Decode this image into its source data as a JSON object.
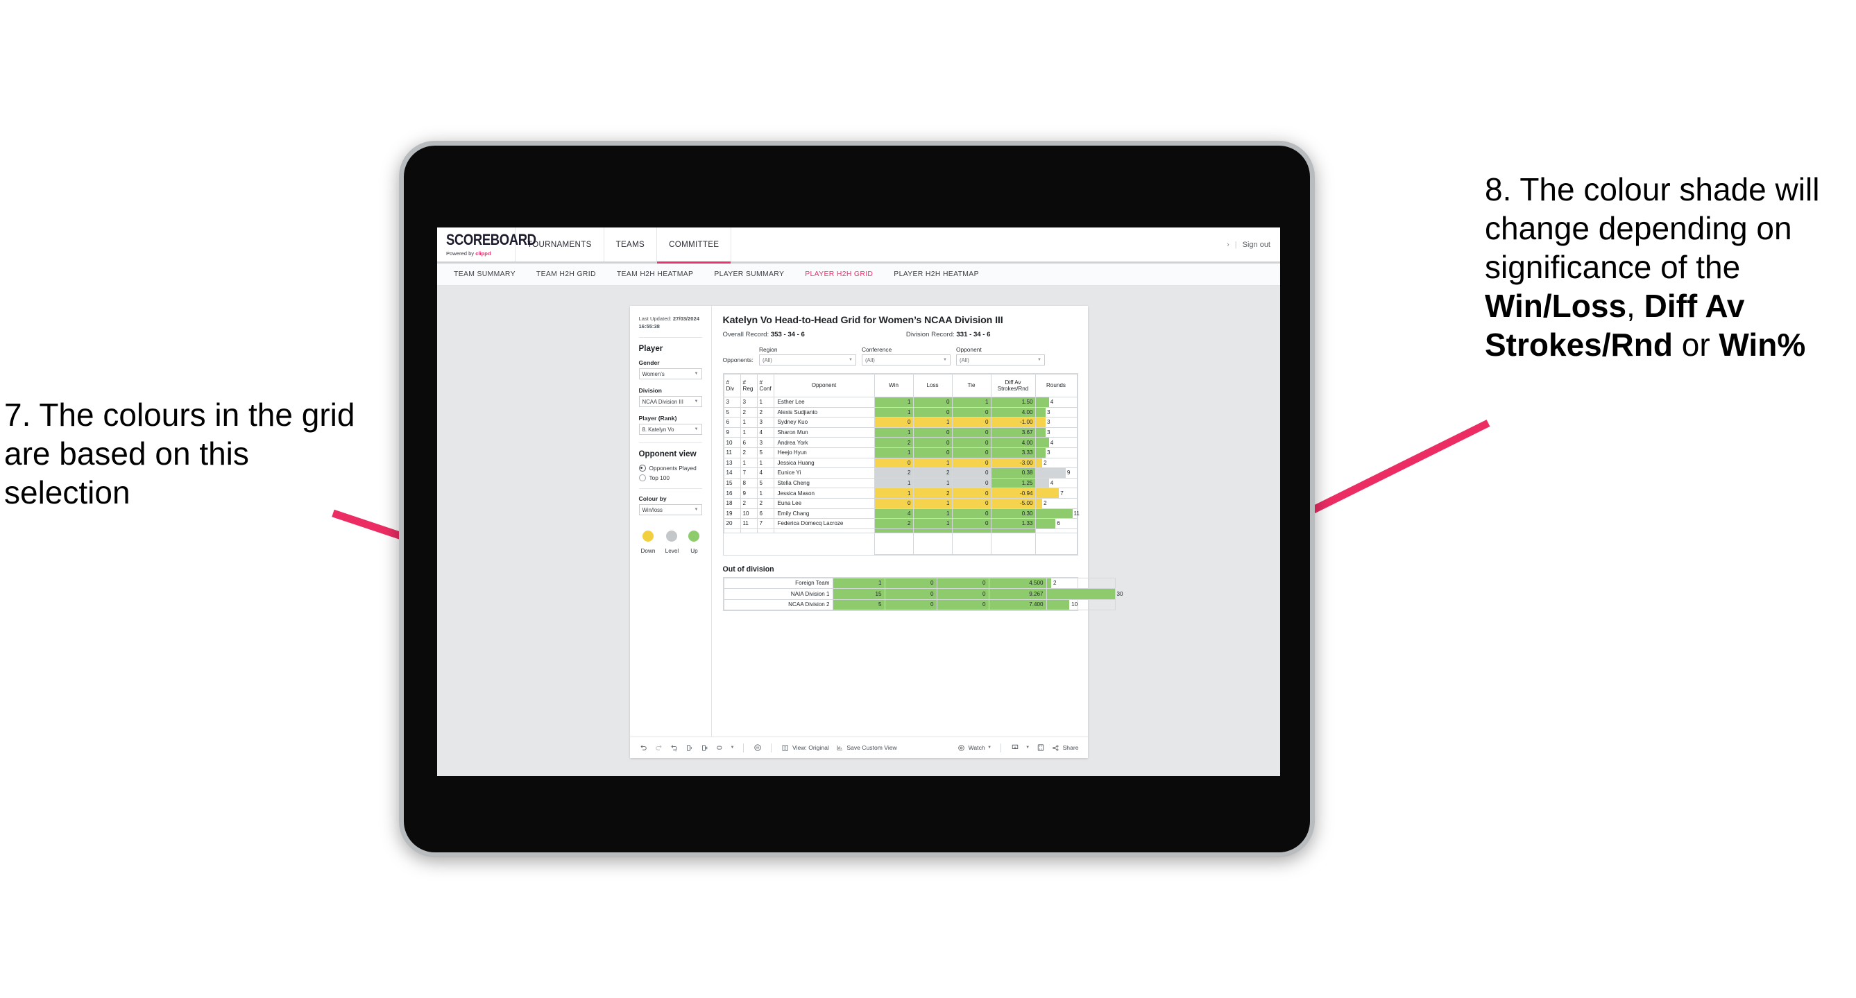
{
  "annotations": {
    "left": "7. The colours in the grid are based on this selection",
    "right_pre": "8. The colour shade will change depending on significance of the ",
    "right_b1": "Win/Loss",
    "right_mid1": ", ",
    "right_b2": "Diff Av Strokes/Rnd",
    "right_mid2": " or ",
    "right_b3": "Win%",
    "arrow_color": "#ec2d64"
  },
  "appbar": {
    "logo_word": "SCOREBOARD",
    "logo_powered": "Powered by ",
    "logo_brand": "clippd",
    "tabs": [
      {
        "label": "TOURNAMENTS",
        "active": false
      },
      {
        "label": "TEAMS",
        "active": false
      },
      {
        "label": "COMMITTEE",
        "active": true
      }
    ],
    "chevron": "›",
    "divider": "|",
    "signout": "Sign out"
  },
  "subnav": {
    "items": [
      {
        "label": "TEAM SUMMARY",
        "active": false
      },
      {
        "label": "TEAM H2H GRID",
        "active": false
      },
      {
        "label": "TEAM H2H HEATMAP",
        "active": false
      },
      {
        "label": "PLAYER SUMMARY",
        "active": false
      },
      {
        "label": "PLAYER H2H GRID",
        "active": true
      },
      {
        "label": "PLAYER H2H HEATMAP",
        "active": false
      }
    ],
    "active_color": "#e8336d"
  },
  "sidebar": {
    "last_updated_label": "Last Updated: ",
    "last_updated_value": "27/03/2024 16:55:38",
    "player_heading": "Player",
    "fields": [
      {
        "label": "Gender",
        "value": "Women’s"
      },
      {
        "label": "Division",
        "value": "NCAA Division III"
      },
      {
        "label": "Player (Rank)",
        "value": "8. Katelyn Vo"
      }
    ],
    "opponent_view_heading": "Opponent view",
    "radios": [
      {
        "label": "Opponents Played",
        "selected": true
      },
      {
        "label": "Top 100",
        "selected": false
      }
    ],
    "colour_by_label": "Colour by",
    "colour_by_value": "Win/loss",
    "legend": [
      {
        "label": "Down",
        "color": "#f2cf3f"
      },
      {
        "label": "Level",
        "color": "#c3c7ca"
      },
      {
        "label": "Up",
        "color": "#8ecb6d"
      }
    ]
  },
  "view": {
    "title": "Katelyn Vo Head-to-Head Grid for Women’s NCAA Division III",
    "overall_label": "Overall Record: ",
    "overall_value": "353 -  34 - 6",
    "division_label": "Division Record: ",
    "division_value": "331 -  34 - 6",
    "opponents_label": "Opponents:",
    "filters": [
      {
        "caption": "Region",
        "value": "(All)"
      },
      {
        "caption": "Conference",
        "value": "(All)"
      },
      {
        "caption": "Opponent",
        "value": "(All)"
      }
    ]
  },
  "chart_data": {
    "type": "table",
    "title": "Katelyn Vo Head-to-Head Grid for Women’s NCAA Division III",
    "columns": [
      "# Div",
      "# Reg",
      "# Conf",
      "Opponent",
      "Win",
      "Loss",
      "Tie",
      "Diff Av Strokes/Rnd",
      "Rounds"
    ],
    "column_headers_multiline": [
      {
        "l1": "#",
        "l2": "Div"
      },
      {
        "l1": "#",
        "l2": "Reg"
      },
      {
        "l1": "#",
        "l2": "Conf"
      },
      {
        "l1": "Opponent",
        "l2": ""
      },
      {
        "l1": "Win",
        "l2": ""
      },
      {
        "l1": "Loss",
        "l2": ""
      },
      {
        "l1": "Tie",
        "l2": ""
      },
      {
        "l1": "Diff Av",
        "l2": "Strokes/Rnd"
      },
      {
        "l1": "Rounds",
        "l2": ""
      }
    ],
    "colour_by": "Win/loss",
    "colour_scale": {
      "up": "#8ecb6d",
      "level": "#d2d5d7",
      "down": "#f5d34c"
    },
    "rounds_max": 30,
    "rows": [
      {
        "div": "3",
        "reg": "3",
        "conf": "1",
        "opponent": "Esther Lee",
        "win": "1",
        "loss": "0",
        "tie": "1",
        "diff": "1.50",
        "rounds": "4",
        "state": "up"
      },
      {
        "div": "5",
        "reg": "2",
        "conf": "2",
        "opponent": "Alexis Sudjianto",
        "win": "1",
        "loss": "0",
        "tie": "0",
        "diff": "4.00",
        "rounds": "3",
        "state": "up"
      },
      {
        "div": "6",
        "reg": "1",
        "conf": "3",
        "opponent": "Sydney Kuo",
        "win": "0",
        "loss": "1",
        "tie": "0",
        "diff": "-1.00",
        "rounds": "3",
        "state": "down"
      },
      {
        "div": "9",
        "reg": "1",
        "conf": "4",
        "opponent": "Sharon Mun",
        "win": "1",
        "loss": "0",
        "tie": "0",
        "diff": "3.67",
        "rounds": "3",
        "state": "up"
      },
      {
        "div": "10",
        "reg": "6",
        "conf": "3",
        "opponent": "Andrea York",
        "win": "2",
        "loss": "0",
        "tie": "0",
        "diff": "4.00",
        "rounds": "4",
        "state": "up"
      },
      {
        "div": "11",
        "reg": "2",
        "conf": "5",
        "opponent": "Heejo Hyun",
        "win": "1",
        "loss": "0",
        "tie": "0",
        "diff": "3.33",
        "rounds": "3",
        "state": "up"
      },
      {
        "div": "13",
        "reg": "1",
        "conf": "1",
        "opponent": "Jessica Huang",
        "win": "0",
        "loss": "1",
        "tie": "0",
        "diff": "-3.00",
        "rounds": "2",
        "state": "down"
      },
      {
        "div": "14",
        "reg": "7",
        "conf": "4",
        "opponent": "Eunice Yi",
        "win": "2",
        "loss": "2",
        "tie": "0",
        "diff": "0.38",
        "rounds": "9",
        "state": "level",
        "diff_state": "up"
      },
      {
        "div": "15",
        "reg": "8",
        "conf": "5",
        "opponent": "Stella Cheng",
        "win": "1",
        "loss": "1",
        "tie": "0",
        "diff": "1.25",
        "rounds": "4",
        "state": "level",
        "diff_state": "up"
      },
      {
        "div": "16",
        "reg": "9",
        "conf": "1",
        "opponent": "Jessica Mason",
        "win": "1",
        "loss": "2",
        "tie": "0",
        "diff": "-0.94",
        "rounds": "7",
        "state": "down"
      },
      {
        "div": "18",
        "reg": "2",
        "conf": "2",
        "opponent": "Euna Lee",
        "win": "0",
        "loss": "1",
        "tie": "0",
        "diff": "-5.00",
        "rounds": "2",
        "state": "down"
      },
      {
        "div": "19",
        "reg": "10",
        "conf": "6",
        "opponent": "Emily Chang",
        "win": "4",
        "loss": "1",
        "tie": "0",
        "diff": "0.30",
        "rounds": "11",
        "state": "up"
      },
      {
        "div": "20",
        "reg": "11",
        "conf": "7",
        "opponent": "Federica Domecq Lacroze",
        "win": "2",
        "loss": "1",
        "tie": "0",
        "diff": "1.33",
        "rounds": "6",
        "state": "up"
      }
    ],
    "out_of_division_title": "Out of division",
    "out_of_division_rows": [
      {
        "name": "Foreign Team",
        "win": "1",
        "loss": "0",
        "tie": "0",
        "diff": "4.500",
        "rounds": "2",
        "state": "up"
      },
      {
        "name": "NAIA Division 1",
        "win": "15",
        "loss": "0",
        "tie": "0",
        "diff": "9.267",
        "rounds": "30",
        "state": "up"
      },
      {
        "name": "NCAA Division 2",
        "win": "5",
        "loss": "0",
        "tie": "0",
        "diff": "7.400",
        "rounds": "10",
        "state": "up"
      }
    ]
  },
  "toolbar": {
    "view_label": "View: Original",
    "save_label": "Save Custom View",
    "watch_label": "Watch",
    "share_label": "Share"
  }
}
